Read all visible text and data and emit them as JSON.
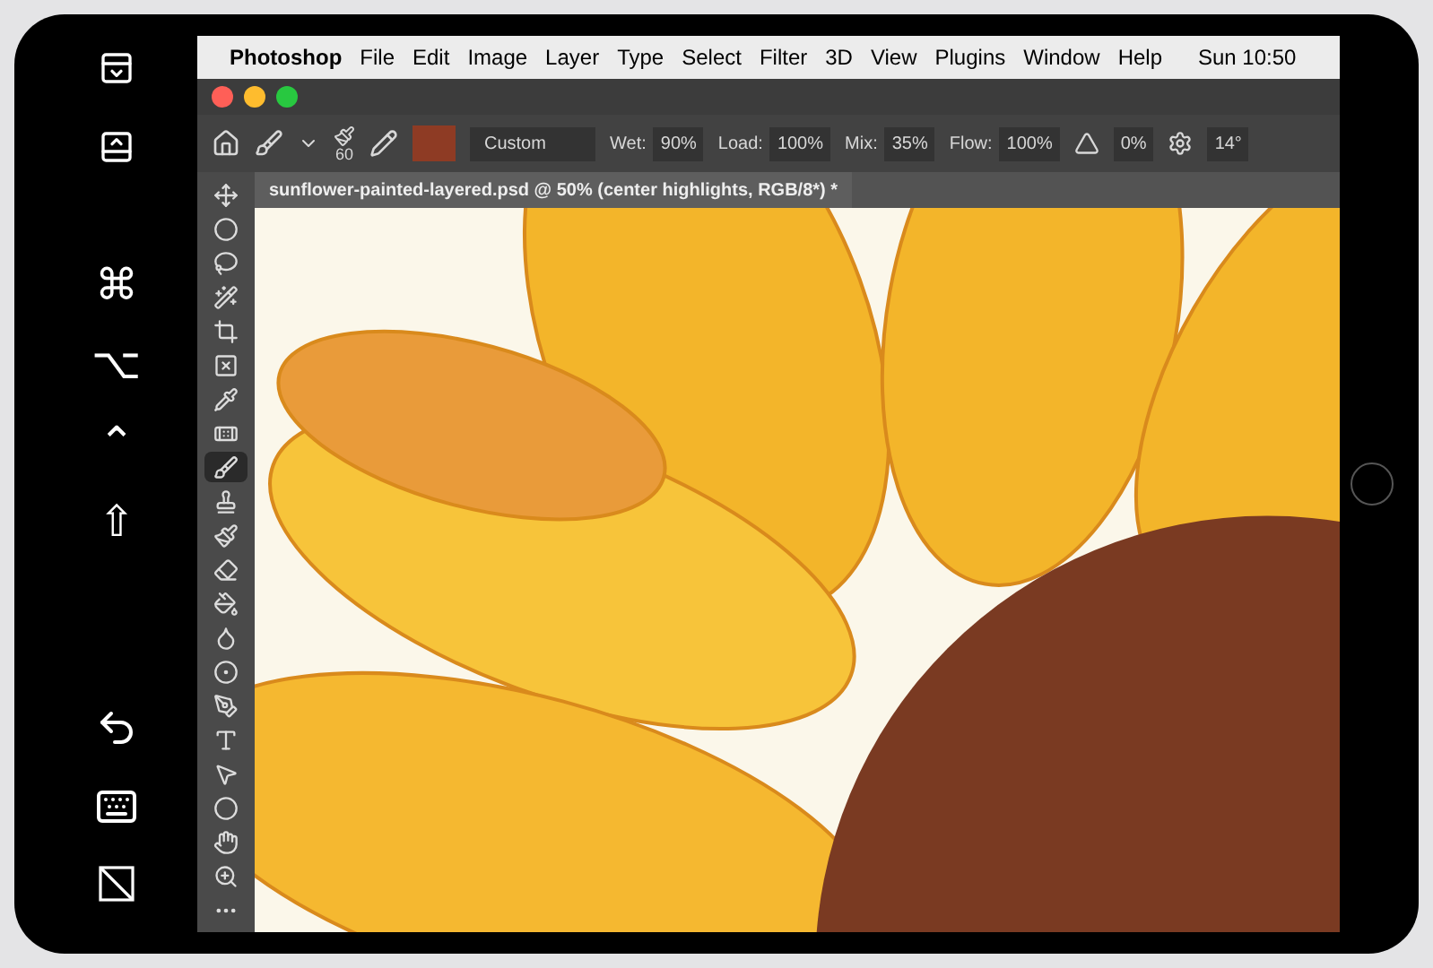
{
  "sidecar": {
    "modifier_keys": [
      "⌘",
      "⌥",
      "⌃",
      "⇧"
    ]
  },
  "menu_bar": {
    "items": [
      {
        "label": "Photoshop",
        "kind": "app"
      },
      {
        "label": "File",
        "kind": "menu"
      },
      {
        "label": "Edit",
        "kind": "menu"
      },
      {
        "label": "Image",
        "kind": "menu"
      },
      {
        "label": "Layer",
        "kind": "menu"
      },
      {
        "label": "Type",
        "kind": "menu"
      },
      {
        "label": "Select",
        "kind": "menu"
      },
      {
        "label": "Filter",
        "kind": "menu"
      },
      {
        "label": "3D",
        "kind": "menu"
      },
      {
        "label": "View",
        "kind": "menu"
      },
      {
        "label": "Plugins",
        "kind": "menu"
      },
      {
        "label": "Window",
        "kind": "menu"
      },
      {
        "label": "Help",
        "kind": "menu"
      }
    ],
    "clock": "Sun 10:50"
  },
  "options_bar": {
    "brush_size": "60",
    "preset": "Custom",
    "fields": [
      {
        "label": "Wet:",
        "value": "90%"
      },
      {
        "label": "Load:",
        "value": "100%"
      },
      {
        "label": "Mix:",
        "value": "35%"
      },
      {
        "label": "Flow:",
        "value": "100%"
      }
    ],
    "smoothing": "0%",
    "angle": "14°"
  },
  "document_tab": {
    "title": "sunflower-painted-layered.psd @ 50% (center highlights, RGB/8*) *"
  },
  "toolbar": {
    "tools": [
      {
        "kind": "move",
        "selected": false
      },
      {
        "kind": "marquee",
        "selected": false
      },
      {
        "kind": "lasso",
        "selected": false
      },
      {
        "kind": "wand",
        "selected": false
      },
      {
        "kind": "crop",
        "selected": false
      },
      {
        "kind": "frame",
        "selected": false
      },
      {
        "kind": "eyedropper",
        "selected": false
      },
      {
        "kind": "healing",
        "selected": false
      },
      {
        "kind": "brush",
        "selected": true
      },
      {
        "kind": "stamp",
        "selected": false
      },
      {
        "kind": "history",
        "selected": false
      },
      {
        "kind": "eraser",
        "selected": false
      },
      {
        "kind": "fill",
        "selected": false
      },
      {
        "kind": "blur",
        "selected": false
      },
      {
        "kind": "dodge",
        "selected": false
      },
      {
        "kind": "pen",
        "selected": false
      },
      {
        "kind": "type",
        "selected": false
      },
      {
        "kind": "path",
        "selected": false
      },
      {
        "kind": "shape",
        "selected": false
      },
      {
        "kind": "hand",
        "selected": false
      },
      {
        "kind": "zoom",
        "selected": false
      },
      {
        "kind": "more",
        "selected": false
      }
    ]
  }
}
